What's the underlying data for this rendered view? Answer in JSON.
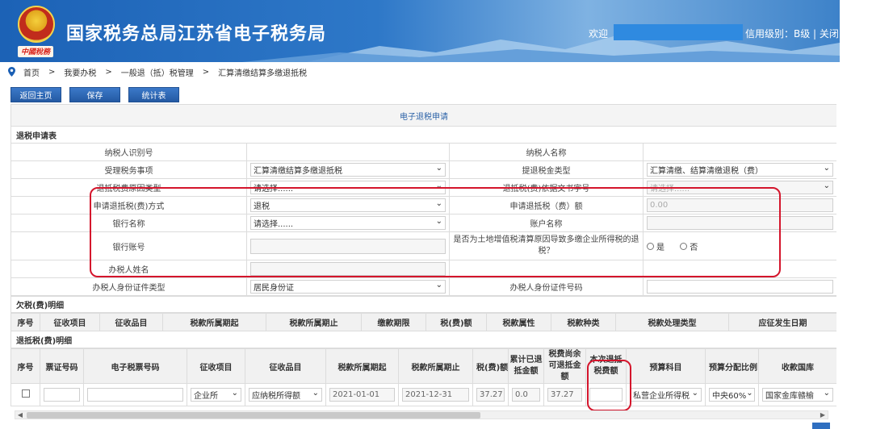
{
  "header": {
    "site_title": "国家税务总局江苏省电子税务局",
    "logo_script": "中國稅務",
    "welcome": "欢迎",
    "user_info": "信用级别：B级 | 关闭"
  },
  "breadcrumb": [
    "首页",
    ">",
    "我要办税",
    ">",
    "一般退（抵）税管理",
    ">",
    "汇算清缴结算多缴退抵税"
  ],
  "toolbar": {
    "home": "返回主页",
    "save": "保存",
    "stats": "统计表"
  },
  "form": {
    "caption": "电子退税申请",
    "section_apply": "退税申请表",
    "rows": {
      "taxpayer_id_label": "纳税人识别号",
      "taxpayer_name_label": "纳税人名称",
      "matter_label": "受理税务事项",
      "matter_value": "汇算清缴结算多缴退抵税",
      "refund_type_label": "提退税金类型",
      "refund_type_value": "汇算清缴、结算清缴退税（费）",
      "reason_label": "退抵税费原因类型",
      "reason_value": "请选择......",
      "doc_label": "退抵税(费)依据文书字号",
      "doc_value": "请选择......",
      "method_label": "申请退抵税(费)方式",
      "method_value": "退税",
      "amount_label": "申请退抵税（费）额",
      "amount_value": "0.00",
      "bank_name_label": "银行名称",
      "bank_name_value": "请选择......",
      "account_name_label": "账户名称",
      "bank_account_label": "银行账号",
      "land_question": "是否为土地增值税清算原因导致多缴企业所得税的退税？",
      "yes": "是",
      "no": "否",
      "agent_name_label": "办税人姓名",
      "agent_id_type_label": "办税人身份证件类型",
      "agent_id_type_value": "居民身份证",
      "agent_id_no_label": "办税人身份证件号码"
    },
    "section_owed": "欠税(费)明细",
    "owed_headers": [
      "序号",
      "征收项目",
      "征收品目",
      "税款所属期起",
      "税款所属期止",
      "缴款期限",
      "税(费)额",
      "税款属性",
      "税款种类",
      "税款处理类型",
      "应征发生日期"
    ],
    "section_refund": "退抵税(费)明细",
    "refund_headers": [
      "序号",
      "票证号码",
      "电子税票号码",
      "征收项目",
      "征收品目",
      "税款所属期起",
      "税款所属期止",
      "税(费)额",
      "累计已退抵金额",
      "税费尚余可退抵金额",
      "本次退抵税费额",
      "预算科目",
      "预算分配比例",
      "收款国库"
    ],
    "refund_row": {
      "item": "企业所",
      "subitem": "应纳税所得额",
      "start": "2021-01-01",
      "end": "2021-12-31",
      "tax": "37.27",
      "refunded": "0.0",
      "remaining": "37.27",
      "current": "",
      "budget": "私营企业所得税",
      "ratio": "中央60%",
      "treasury": "国家金库赣榆"
    }
  },
  "colors": {
    "header_blue": "#1c62b6",
    "button_blue": "#2d67b3",
    "highlight_red": "#d4152c",
    "caption_blue": "#2d63a8"
  }
}
